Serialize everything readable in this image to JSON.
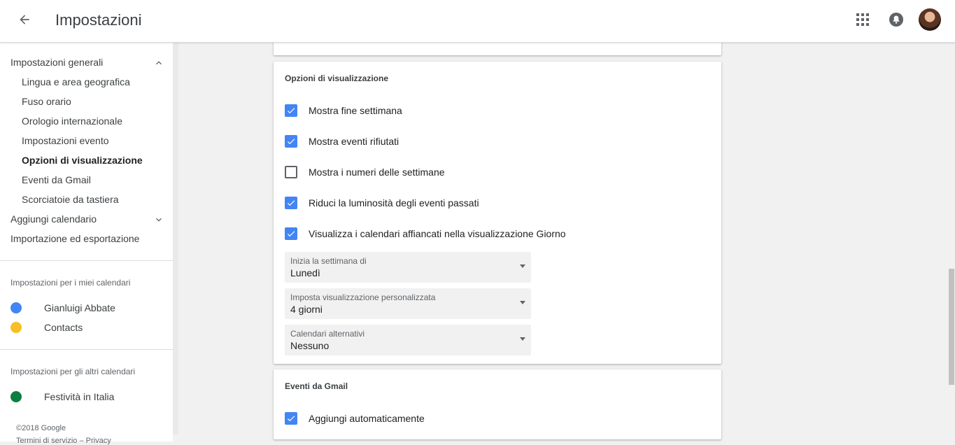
{
  "header": {
    "title": "Impostazioni",
    "icons": {
      "back": "arrow-back-icon",
      "apps": "apps-grid-icon",
      "notifications": "bell-icon",
      "account": "avatar"
    }
  },
  "sidebar": {
    "general": {
      "label": "Impostazioni generali",
      "items": [
        {
          "label": "Lingua e area geografica"
        },
        {
          "label": "Fuso orario"
        },
        {
          "label": "Orologio internazionale"
        },
        {
          "label": "Impostazioni evento"
        },
        {
          "label": "Opzioni di visualizzazione"
        },
        {
          "label": "Eventi da Gmail"
        },
        {
          "label": "Scorciatoie da tastiera"
        }
      ]
    },
    "add_calendar": "Aggiungi calendario",
    "import_export": "Importazione ed esportazione",
    "my_calendars": {
      "label": "Impostazioni per i miei calendari",
      "items": [
        {
          "name": "Gianluigi Abbate",
          "color": "#4285f4"
        },
        {
          "name": "Contacts",
          "color": "#f6bf26"
        }
      ]
    },
    "other_calendars": {
      "label": "Impostazioni per gli altri calendari",
      "items": [
        {
          "name": "Festività in Italia",
          "color": "#0b8043"
        }
      ]
    },
    "footer": {
      "copyright": "©2018 Google",
      "links": "Termini di servizio – Privacy"
    }
  },
  "display_options": {
    "title": "Opzioni di visualizzazione",
    "checkboxes": [
      {
        "label": "Mostra fine settimana",
        "checked": true
      },
      {
        "label": "Mostra eventi rifiutati",
        "checked": true
      },
      {
        "label": "Mostra i numeri delle settimane",
        "checked": false
      },
      {
        "label": "Riduci la luminosità degli eventi passati",
        "checked": true
      },
      {
        "label": "Visualizza i calendari affiancati nella visualizzazione Giorno",
        "checked": true
      }
    ],
    "selects": [
      {
        "label": "Inizia la settimana di",
        "value": "Lunedì"
      },
      {
        "label": "Imposta visualizzazione personalizzata",
        "value": "4 giorni"
      },
      {
        "label": "Calendari alternativi",
        "value": "Nessuno"
      }
    ]
  },
  "gmail_events": {
    "title": "Eventi da Gmail",
    "checkbox": {
      "label": "Aggiungi automaticamente",
      "checked": true
    }
  },
  "colors": {
    "accent": "#4285f4"
  }
}
